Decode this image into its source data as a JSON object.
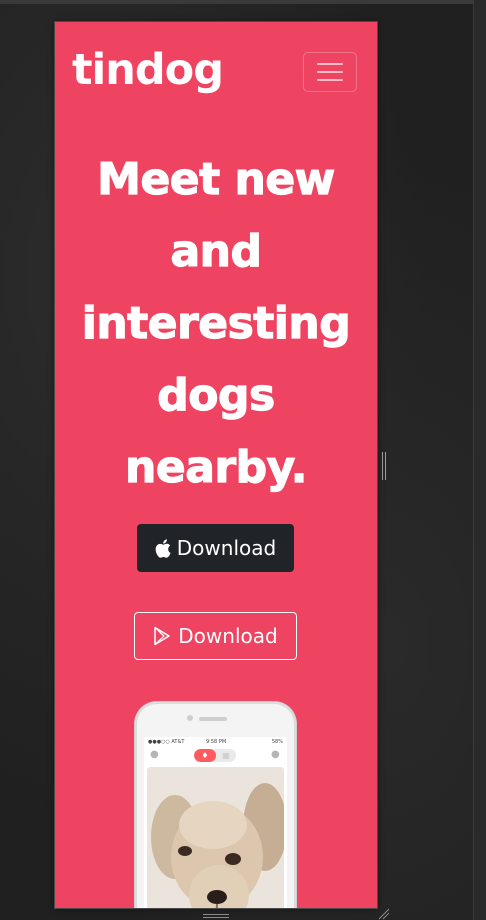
{
  "site": {
    "brand": "tindog",
    "headline": [
      "Meet new",
      "and",
      "interesting",
      "dogs",
      "nearby."
    ]
  },
  "buttons": {
    "apple_download": {
      "label": "Download",
      "icon": "apple-icon"
    },
    "play_download": {
      "label": "Download",
      "icon": "play-icon"
    }
  },
  "phone": {
    "status_carrier": "●●●○○ AT&T",
    "status_time": "9:58 PM",
    "status_battery": "58%"
  },
  "colors": {
    "brand_red": "#ef4461",
    "dark_button": "#202328",
    "text": "#ffffff"
  }
}
